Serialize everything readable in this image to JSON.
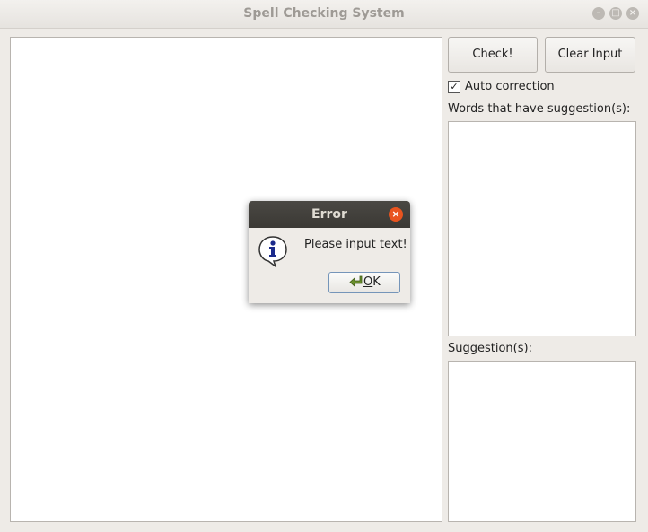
{
  "window": {
    "title": "Spell Checking System",
    "controls": {
      "minimize": "–",
      "maximize": "□",
      "close": "×"
    }
  },
  "main": {
    "check_label": "Check!",
    "clear_label": "Clear Input",
    "auto_correction_label": "Auto correction",
    "auto_correction_checked": true,
    "words_label": "Words that have suggestion(s):",
    "suggestions_label": "Suggestion(s):"
  },
  "dialog": {
    "title": "Error",
    "message": "Please input text!",
    "ok_mnemonic": "O",
    "ok_rest": "K",
    "icon": "info-icon",
    "close_glyph": "×"
  },
  "icons": {
    "check_mark": "✓"
  },
  "colors": {
    "window_bg": "#eeebe7",
    "dialog_titlebar": "#3b3935",
    "close_accent": "#e9541f",
    "ok_border": "#7595b9"
  }
}
